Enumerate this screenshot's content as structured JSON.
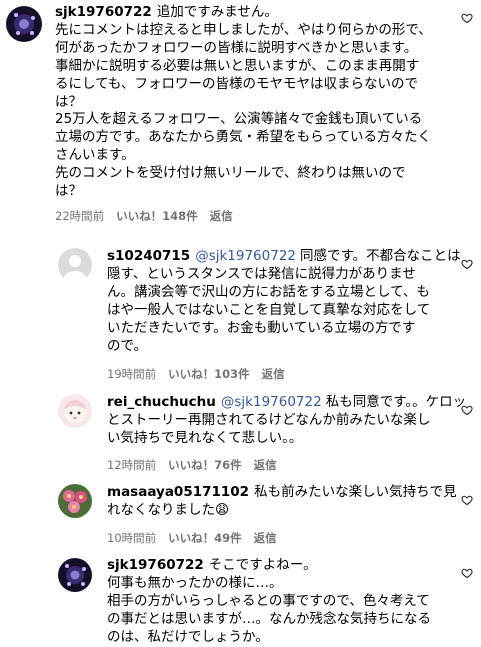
{
  "comments": [
    {
      "username": "sjk19760722",
      "mention": "",
      "lines": [
        "追加ですみません。",
        "先にコメントは控えると申しましたが、やはり何らかの形で、",
        "何があったかフォロワーの皆様に説明すべきかと思います。",
        "事細かに説明する必要は無いと思いますが、このまま再開す",
        "るにしても、フォロワーの皆様のモヤモヤは収まらないので",
        "は？",
        "25万人を超えるフォロワー、公演等諸々で金銭も頂いている",
        "立場の方です。あなたから勇気・希望をもらっている方々たく",
        "さんいます。",
        "先のコメントを受け付け無いリールで、終わりは無いので",
        "は？"
      ],
      "time": "22時間前",
      "likes": "いいね！148件",
      "reply": "返信"
    },
    {
      "username": "s10240715",
      "mention": "@sjk19760722",
      "lines": [
        "同感です。不都合なことは",
        "隠す、というスタンスでは発信に説得力がありませ",
        "ん。講演会等で沢山の方にお話をする立場として、も",
        "はや一般人ではないことを自覚して真摯な対応をして",
        "いただきたいです。お金も動いている立場の方です",
        "ので。"
      ],
      "time": "19時間前",
      "likes": "いいね！103件",
      "reply": "返信"
    },
    {
      "username": "rei_chuchuchu",
      "mention": "@sjk19760722",
      "lines": [
        "私も同意です。。ケロッ",
        "とストーリー再開されてるけどなんか前みたいな楽し",
        "い気持ちで見れなくて悲しい。。"
      ],
      "time": "12時間前",
      "likes": "いいね！76件",
      "reply": "返信"
    },
    {
      "username": "masaaya05171102",
      "mention": "",
      "lines": [
        "私も前みたいな楽しい気持ちで見",
        "れなくなりました😩"
      ],
      "time": "10時間前",
      "likes": "いいね！49件",
      "reply": "返信"
    },
    {
      "username": "sjk19760722",
      "mention": "",
      "lines": [
        "そこですよねー。",
        "何事も無かったかの様に…。",
        "相手の方がいらっしゃるとの事ですので、色々考えて",
        "の事だとは思いますが…。なんか残念な気持ちになる",
        "のは、私だけでしょうか。"
      ],
      "time": "",
      "likes": "",
      "reply": ""
    }
  ]
}
